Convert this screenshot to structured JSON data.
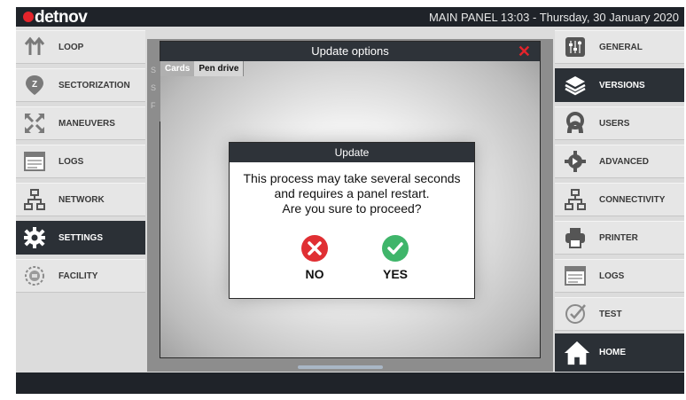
{
  "topbar": {
    "logo": "detnov",
    "status": "MAIN PANEL  13:03 - Thursday, 30 January 2020"
  },
  "left_menu": [
    {
      "label": "LOOP",
      "icon": "loop-icon"
    },
    {
      "label": "SECTORIZATION",
      "icon": "sectorization-icon"
    },
    {
      "label": "MANEUVERS",
      "icon": "maneuvers-icon"
    },
    {
      "label": "LOGS",
      "icon": "logs-icon"
    },
    {
      "label": "NETWORK",
      "icon": "network-icon"
    },
    {
      "label": "SETTINGS",
      "icon": "gear-icon",
      "active": true
    },
    {
      "label": "FACILITY",
      "icon": "facility-icon"
    }
  ],
  "right_menu": [
    {
      "label": "GENERAL",
      "icon": "general-icon"
    },
    {
      "label": "VERSIONS",
      "icon": "layers-icon",
      "active": true
    },
    {
      "label": "USERS",
      "icon": "users-icon"
    },
    {
      "label": "ADVANCED",
      "icon": "advanced-gear-icon"
    },
    {
      "label": "CONNECTIVITY",
      "icon": "connectivity-icon"
    },
    {
      "label": "PRINTER",
      "icon": "printer-icon"
    },
    {
      "label": "LOGS",
      "icon": "logs-icon"
    },
    {
      "label": "TEST",
      "icon": "test-check-icon"
    }
  ],
  "home": {
    "label": "HOME",
    "icon": "home-icon"
  },
  "update_window": {
    "title": "Update options",
    "close_icon": "close-icon",
    "tabs": [
      "Cards",
      "Pen drive"
    ],
    "strip_letters": [
      "S",
      "S",
      "F"
    ]
  },
  "dialog": {
    "title": "Update",
    "message_lines": [
      "This process may take several seconds",
      "and requires a panel restart.",
      "Are you sure to proceed?"
    ],
    "no_label": "NO",
    "yes_label": "YES"
  },
  "colors": {
    "brand_red": "#e4242b",
    "dark_bar": "#1f2329",
    "active_item": "#2b3036",
    "no_red": "#e02f33",
    "yes_green": "#3fb56a"
  }
}
